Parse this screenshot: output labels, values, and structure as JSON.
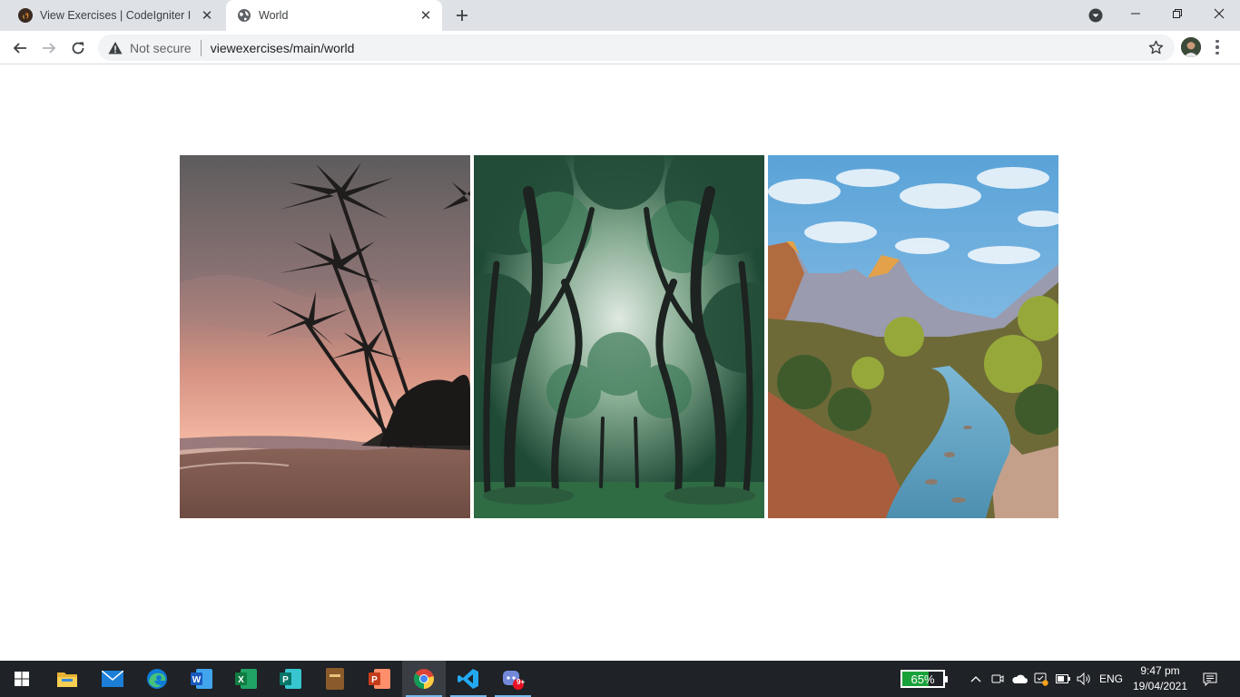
{
  "browser": {
    "tabs": [
      {
        "title": "View Exercises | CodeIgniter I",
        "favicon": "codeigniter-flame-icon",
        "active": false
      },
      {
        "title": "World",
        "favicon": "globe-icon",
        "active": true
      }
    ],
    "address_bar": {
      "security_label": "Not secure",
      "url": "viewexercises/main/world"
    }
  },
  "page": {
    "images": [
      {
        "subject": "palm-trees-beach-sunset"
      },
      {
        "subject": "forest-tree-canopy"
      },
      {
        "subject": "canyon-river-mountains"
      }
    ]
  },
  "taskbar": {
    "pinned": [
      "start-icon",
      "file-explorer-icon",
      "mail-icon",
      "edge-icon",
      "word-icon",
      "excel-icon",
      "publisher-icon",
      "bible-app-icon",
      "powerpoint-icon",
      "chrome-icon",
      "vscode-icon",
      "discord-icon"
    ],
    "discord_badge": "9+",
    "battery_percent": "65%",
    "battery_level": 0.65,
    "language": "ENG",
    "time": "9:47 pm",
    "date": "19/04/2021"
  },
  "colors": {
    "tabstrip": "#dee1e6",
    "taskbar": "#1f2226",
    "battery_green": "#1aa13a"
  }
}
